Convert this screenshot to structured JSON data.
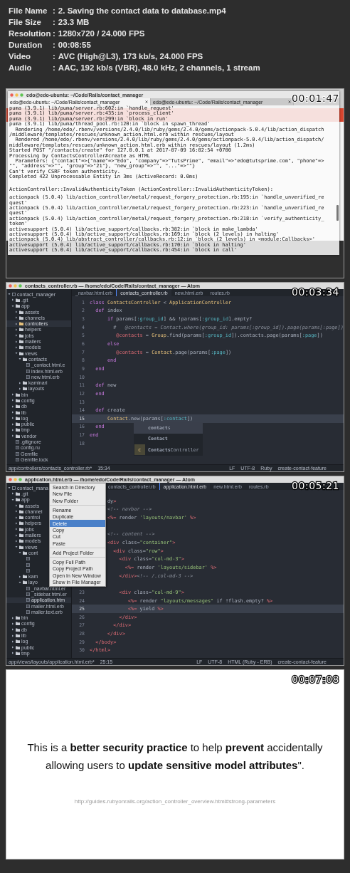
{
  "file_info": [
    {
      "label": "File Name",
      "separator": ":",
      "value": "2. Saving the contact data to database.mp4"
    },
    {
      "label": "File Size",
      "separator": ":",
      "value": "23.3 MB"
    },
    {
      "label": "Resolution",
      "separator": ":",
      "value": "1280x720 / 24.000 FPS"
    },
    {
      "label": "Duration",
      "separator": ":",
      "value": "00:08:55"
    },
    {
      "label": "Video",
      "separator": ":",
      "value": "AVC (High@L3), 173 kb/s, 24.000 FPS"
    },
    {
      "label": "Audio",
      "separator": ":",
      "value": "AAC, 192 kb/s (VBR), 48.0 kHz, 2 channels, 1 stream"
    }
  ],
  "frames": [
    {
      "kind": "terminal",
      "timestamp": "00:01:47",
      "window_title": "edo@edo-ubuntu: ~/Code/Rails/contact_manager",
      "tabs": [
        {
          "label": "edo@edo-ubuntu: ~/Code/Rails/contact_manager",
          "selected": true
        },
        {
          "label": "edo@edo-ubuntu: ~/Code/Rails/contact_manager",
          "selected": false
        }
      ],
      "blocks": [
        [
          "puma (3.9.1) lib/puma/server.rb:602:in `handle_request'",
          "puma (3.9.1) lib/puma/server.rb:435:in `process_client'",
          "puma (3.9.1) lib/puma/server.rb:299:in `block in run'",
          "puma (3.9.1) lib/puma/thread_pool.rb:120:in `block in spawn_thread'",
          "  Rendering /home/edo/.rbenv/versions/2.4.0/lib/ruby/gems/2.4.0/gems/actionpack-5.0.4/lib/action_dispatch",
          "/middleware/templates/rescues/unknown_action.html.erb within rescues/layout",
          "  Rendered /home/edo/.rbenv/versions/2.4.0/lib/ruby/gems/2.4.0/gems/actionpack-5.0.4/lib/action_dispatch/",
          "middleware/templates/rescues/unknown_action.html.erb within rescues/layout (1.2ms)",
          "Started POST \"/contacts/create\" for 127.0.0.1 at 2017-07-09 16:02:54 +0700",
          "Processing by ContactsController#create as HTML",
          "  Parameters: {\"contact\"=>{\"name\"=>\"Edo\", \"company\"=>\"TutsPrime\", \"email\"=>\"edo@tutsprime.com\", \"phone\"=>",
          "\"\", \"address\"=>\"\", \"group\"=>\"21\"}, \"new_group\"=>\"\", \"...\"=>\"\"}",
          "Can't verify CSRF token authenticity.",
          "Completed 422 Unprocessable Entity in 3ms (ActiveRecord: 0.0ms)"
        ],
        [
          "ActionController::InvalidAuthenticityToken (ActionController::InvalidAuthenticityToken):"
        ],
        [
          "actionpack (5.0.4) lib/action_controller/metal/request_forgery_protection.rb:195:in `handle_unverified_re",
          "quest'",
          "actionpack (5.0.4) lib/action_controller/metal/request_forgery_protection.rb:223:in `handle_unverified_re",
          "quest'",
          "actionpack (5.0.4) lib/action_controller/metal/request_forgery_protection.rb:218:in `verify_authenticity_",
          "token'",
          "activesupport (5.0.4) lib/active_support/callbacks.rb:382:in `block in make_lambda'",
          "activesupport (5.0.4) lib/active_support/callbacks.rb:169:in `block (2 levels) in halting'",
          "actionpack (5.0.4) lib/abstract_controller/callbacks.rb:12:in `block (2 levels) in <module:Callbacks>'",
          "activesupport (5.0.4) lib/active_support/callbacks.rb:170:in `block in halting'",
          "activesupport (5.0.4) lib/active_support/callbacks.rb:454:in `block in call'"
        ]
      ]
    },
    {
      "kind": "editor",
      "timestamp": "00:03:34",
      "window_title": "contacts_controller.rb — /home/edo/Code/Rails/contact_manager — Atom",
      "tree": [
        {
          "label": "contact_manager",
          "kind": "project",
          "expanded": true,
          "selected": false,
          "children": [
            {
              "label": ".git",
              "kind": "folder",
              "expanded": false,
              "selected": false
            },
            {
              "label": "app",
              "kind": "folder",
              "expanded": true,
              "selected": false,
              "children": [
                {
                  "label": "assets",
                  "kind": "folder",
                  "expanded": false,
                  "selected": false
                },
                {
                  "label": "channels",
                  "kind": "folder",
                  "expanded": false,
                  "selected": false
                },
                {
                  "label": "controllers",
                  "kind": "folder",
                  "expanded": false,
                  "selected": true
                },
                {
                  "label": "helpers",
                  "kind": "folder",
                  "expanded": false,
                  "selected": false
                },
                {
                  "label": "jobs",
                  "kind": "folder",
                  "expanded": false,
                  "selected": false
                },
                {
                  "label": "mailers",
                  "kind": "folder",
                  "expanded": false,
                  "selected": false
                },
                {
                  "label": "models",
                  "kind": "folder",
                  "expanded": false,
                  "selected": false
                },
                {
                  "label": "views",
                  "kind": "folder",
                  "expanded": true,
                  "selected": false,
                  "children": [
                    {
                      "label": "contacts",
                      "kind": "folder",
                      "expanded": true,
                      "selected": false,
                      "children": [
                        {
                          "label": "_contact.html.e",
                          "kind": "file",
                          "selected": false
                        },
                        {
                          "label": "index.html.erb",
                          "kind": "file",
                          "selected": false
                        },
                        {
                          "label": "new.html.erb",
                          "kind": "file",
                          "selected": false
                        }
                      ]
                    },
                    {
                      "label": "kaminari",
                      "kind": "folder",
                      "expanded": false,
                      "selected": false
                    },
                    {
                      "label": "layouts",
                      "kind": "folder",
                      "expanded": false,
                      "selected": false
                    }
                  ]
                }
              ]
            },
            {
              "label": "bin",
              "kind": "folder",
              "expanded": false,
              "selected": false
            },
            {
              "label": "config",
              "kind": "folder",
              "expanded": false,
              "selected": false
            },
            {
              "label": "db",
              "kind": "folder",
              "expanded": false,
              "selected": false
            },
            {
              "label": "lib",
              "kind": "folder",
              "expanded": false,
              "selected": false
            },
            {
              "label": "log",
              "kind": "folder",
              "expanded": false,
              "selected": false
            },
            {
              "label": "public",
              "kind": "folder",
              "expanded": false,
              "selected": false
            },
            {
              "label": "tmp",
              "kind": "folder",
              "expanded": false,
              "selected": false
            },
            {
              "label": "vendor",
              "kind": "folder",
              "expanded": false,
              "selected": false
            },
            {
              "label": ".gitignore",
              "kind": "file",
              "selected": false
            },
            {
              "label": "config.ru",
              "kind": "file",
              "selected": false
            },
            {
              "label": "Gemfile",
              "kind": "file",
              "selected": false
            },
            {
              "label": "Gemfile.lock",
              "kind": "file",
              "selected": false
            }
          ]
        }
      ],
      "tabs": [
        {
          "label": "_navbar.html.erb",
          "selected": false
        },
        {
          "label": "contacts_controller.rb",
          "selected": true
        },
        {
          "label": "new.html.erb",
          "selected": false
        },
        {
          "label": "routes.rb",
          "selected": false
        }
      ],
      "code": [
        {
          "number": "1",
          "text": "class ContactsController < ApplicationController",
          "current": false
        },
        {
          "number": "2",
          "text": "  def index",
          "current": false
        },
        {
          "number": "3",
          "text": "      if params[:group_id] && !params[:group_id].empty?",
          "current": false
        },
        {
          "number": "4",
          "text": "        #   @contacts = Contact.where(group_id: params[:group_id]).page(params[:page])",
          "current": false
        },
        {
          "number": "5",
          "text": "         @contacts = Group.find(params[:group_id]).contacts.page(params[:page])",
          "current": false
        },
        {
          "number": "6",
          "text": "      else",
          "current": false
        },
        {
          "number": "7",
          "text": "         @contacts = Contact.page(params[:page])",
          "current": false
        },
        {
          "number": "8",
          "text": "      end",
          "current": false
        },
        {
          "number": "9",
          "text": "  end",
          "current": false
        },
        {
          "number": "10",
          "current": false
        },
        {
          "number": "11",
          "text": "  def new",
          "current": false
        },
        {
          "number": "12",
          "text": "  end",
          "current": false
        },
        {
          "number": "13",
          "current": false
        },
        {
          "number": "14",
          "text": "  def create",
          "current": false
        },
        {
          "number": "15",
          "text": "      Contact.new(params[:contact])",
          "current": true
        },
        {
          "number": "16",
          "text": "  end",
          "current": false
        },
        {
          "number": "17",
          "text": "end",
          "current": false
        },
        {
          "number": "18",
          "current": false
        }
      ],
      "autocomplete": [
        {
          "text": "**contact**s",
          "selected": true
        },
        {
          "text": "**Contact**",
          "selected": false
        },
        {
          "text": "**Contacts**Controller",
          "selected": false,
          "badge": "c"
        }
      ],
      "status_left": [
        "app/controllers/contacts_controller.rb*",
        "15:34"
      ],
      "status_right": [
        "LF",
        "UTF-8",
        "Ruby",
        "create-contact-feature"
      ]
    },
    {
      "kind": "editor",
      "timestamp": "00:05:21",
      "window_title": "application.html.erb — /home/edo/Code/Rails/contact_manager — Atom",
      "tree": [
        {
          "label": "contact_mana",
          "kind": "project",
          "expanded": true,
          "selected": false,
          "children": [
            {
              "label": ".git",
              "kind": "folder",
              "expanded": false,
              "selected": false
            },
            {
              "label": "app",
              "kind": "folder",
              "expanded": true,
              "selected": false,
              "children": [
                {
                  "label": "assets",
                  "kind": "folder",
                  "expanded": false,
                  "selected": false
                },
                {
                  "label": "channel",
                  "kind": "folder",
                  "expanded": false,
                  "selected": false
                },
                {
                  "label": "control",
                  "kind": "folder",
                  "expanded": false,
                  "selected": false
                },
                {
                  "label": "helpers",
                  "kind": "folder",
                  "expanded": false,
                  "selected": false
                },
                {
                  "label": "jobs",
                  "kind": "folder",
                  "expanded": false,
                  "selected": false
                },
                {
                  "label": "mailers",
                  "kind": "folder",
                  "expanded": false,
                  "selected": false
                },
                {
                  "label": "models",
                  "kind": "folder",
                  "expanded": false,
                  "selected": false
                },
                {
                  "label": "views",
                  "kind": "folder",
                  "expanded": true,
                  "selected": false,
                  "children": [
                    {
                      "label": "cont",
                      "kind": "folder",
                      "expanded": true,
                      "selected": false,
                      "children": [
                        {
                          "kind": "file",
                          "selected": false
                        },
                        {
                          "kind": "file",
                          "selected": false
                        },
                        {
                          "kind": "file",
                          "selected": false
                        }
                      ]
                    },
                    {
                      "label": "kam",
                      "kind": "folder",
                      "expanded": false,
                      "selected": false
                    },
                    {
                      "label": "layo",
                      "kind": "folder",
                      "expanded": true,
                      "selected": false,
                      "children": [
                        {
                          "label": "_navbar.html.er",
                          "kind": "file",
                          "selected": false
                        },
                        {
                          "label": "_sidebar.html.er",
                          "kind": "file",
                          "selected": false
                        },
                        {
                          "label": "application.htm",
                          "kind": "file",
                          "selected": true
                        },
                        {
                          "label": "mailer.html.erb",
                          "kind": "file",
                          "selected": false
                        },
                        {
                          "label": "mailer.text.erb",
                          "kind": "file",
                          "selected": false
                        }
                      ]
                    }
                  ]
                }
              ]
            },
            {
              "label": "bin",
              "kind": "folder",
              "expanded": false,
              "selected": false
            },
            {
              "label": "config",
              "kind": "folder",
              "expanded": false,
              "selected": false
            },
            {
              "label": "db",
              "kind": "folder",
              "expanded": false,
              "selected": false
            },
            {
              "label": "lib",
              "kind": "folder",
              "expanded": false,
              "selected": false
            },
            {
              "label": "log",
              "kind": "folder",
              "expanded": false,
              "selected": false
            },
            {
              "label": "public",
              "kind": "folder",
              "expanded": false,
              "selected": false
            },
            {
              "label": "tmp",
              "kind": "folder",
              "expanded": false,
              "selected": false
            }
          ]
        }
      ],
      "tabs": [
        {
          "label": "contacts_controller.rb",
          "selected": false
        },
        {
          "label": "application.html.erb",
          "selected": true
        },
        {
          "label": "new.html.erb",
          "selected": false
        },
        {
          "label": "routes.rb",
          "selected": false
        }
      ],
      "code": [
        {
          "text": "      dy>",
          "current": false
        },
        {
          "text": "      <!-- navbar -->",
          "current": false
        },
        {
          "text": "      <%= render 'layouts/navbar' %>",
          "current": false
        },
        {
          "current": false
        },
        {
          "text": "      <!-- content -->",
          "current": false
        },
        {
          "text": "      <div class=\"container\">",
          "current": false
        },
        {
          "text": "        <div class=\"row\">",
          "current": false
        },
        {
          "text": "          <div class=\"col-md-3\">",
          "current": false
        },
        {
          "text": "            <%= render 'layouts/sidebar' %>",
          "current": false
        },
        {
          "text": "          </div><!-- /.col-md-3 -->",
          "current": false
        },
        {
          "current": false
        },
        {
          "number": "23",
          "text": "          <div class=\"col-md-9\">",
          "current": false
        },
        {
          "number": "24",
          "text": "             <%= render \"layouts/messages\" if !flash.empty? %>",
          "current": false
        },
        {
          "number": "25",
          "text": "             <%= yield %>",
          "current": true
        },
        {
          "number": "26",
          "text": "          </div>",
          "current": false
        },
        {
          "number": "27",
          "text": "        </div>",
          "current": false
        },
        {
          "number": "28",
          "text": "      </div>",
          "current": false
        },
        {
          "number": "29",
          "text": "  </body>",
          "current": false
        },
        {
          "number": "30",
          "text": "</html>",
          "current": false
        }
      ],
      "context_menu": [
        [
          {
            "label": "Search in Directory",
            "selected": false
          },
          {
            "label": "New File",
            "selected": false
          },
          {
            "label": "New Folder",
            "selected": false
          }
        ],
        [
          {
            "label": "Rename",
            "selected": false
          },
          {
            "label": "Duplicate",
            "selected": false
          },
          {
            "label": "Delete",
            "selected": true
          },
          {
            "label": "Copy",
            "selected": false
          },
          {
            "label": "Cut",
            "selected": false
          },
          {
            "label": "Paste",
            "selected": false
          }
        ],
        [
          {
            "label": "Add Project Folder",
            "selected": false
          }
        ],
        [
          {
            "label": "Copy Full Path",
            "selected": false
          },
          {
            "label": "Copy Project Path",
            "selected": false
          },
          {
            "label": "Open In New Window",
            "selected": false
          },
          {
            "label": "Show in File Manager",
            "selected": false
          }
        ]
      ],
      "status_left": [
        "app/views/layouts/application.html.erb*",
        "25:15"
      ],
      "status_right": [
        "LF",
        "UTF-8",
        "HTML (Ruby - ERB)",
        "create-contact-feature"
      ]
    },
    {
      "kind": "slide",
      "timestamp": "00:07:08",
      "quote": "This is a **better security practice** to help **prevent** accidentally allowing users to **update sensitive model attributes**\".",
      "link": "http://guides.rubyonrails.org/action_controller_overview.html#strong-parameters"
    }
  ]
}
